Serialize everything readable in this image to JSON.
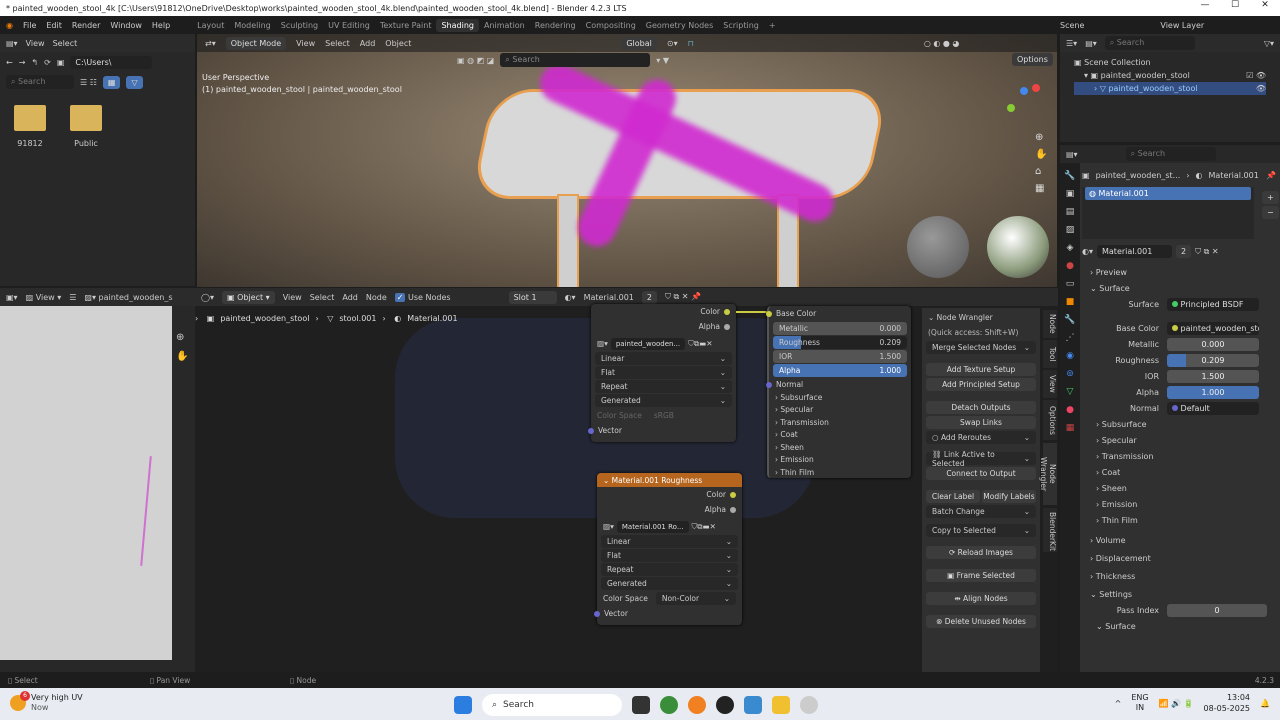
{
  "title": "* painted_wooden_stool_4k [C:\\Users\\91812\\OneDrive\\Desktop\\works\\painted_wooden_stool_4k.blend\\painted_wooden_stool_4k.blend] - Blender 4.2.3 LTS",
  "menu": [
    "File",
    "Edit",
    "Render",
    "Window",
    "Help"
  ],
  "workspaces": [
    "Layout",
    "Modeling",
    "Sculpting",
    "UV Editing",
    "Texture Paint",
    "Shading",
    "Animation",
    "Rendering",
    "Compositing",
    "Geometry Nodes",
    "Scripting"
  ],
  "active_workspace": "Shading",
  "filebrowser": {
    "view": "View",
    "select": "Select",
    "path": "C:\\Users\\",
    "search_placeholder": "Search",
    "items": [
      "91812",
      "Public"
    ]
  },
  "viewport": {
    "mode": "Object Mode",
    "menus": [
      "View",
      "Select",
      "Add",
      "Object"
    ],
    "orientation": "Global",
    "search_placeholder": "Search",
    "options": "Options",
    "perspective": "User Perspective",
    "object_info": "(1) painted_wooden_stool | painted_wooden_stool"
  },
  "outliner": {
    "scene": "Scene",
    "view_layer": "View Layer",
    "search_placeholder": "Search",
    "items": [
      "Scene Collection",
      "painted_wooden_stool",
      "painted_wooden_stool"
    ]
  },
  "properties": {
    "search_placeholder": "Search",
    "breadcrumb_object": "painted_wooden_st...",
    "breadcrumb_material": "Material.001",
    "slot": "Material.001",
    "material_name": "Material.001",
    "users": "2",
    "sections": {
      "preview": "Preview",
      "surface": "Surface",
      "volume": "Volume",
      "displacement": "Displacement",
      "thickness": "Thickness",
      "settings": "Settings",
      "surface2": "Surface"
    },
    "surface_label": "Surface",
    "surface_value": "Principled BSDF",
    "fields": [
      {
        "label": "Base Color",
        "value": "painted_wooden_sto..."
      },
      {
        "label": "Metallic",
        "value": "0.000"
      },
      {
        "label": "Roughness",
        "value": "0.209"
      },
      {
        "label": "IOR",
        "value": "1.500"
      },
      {
        "label": "Alpha",
        "value": "1.000"
      },
      {
        "label": "Normal",
        "value": "Default"
      }
    ],
    "subs": [
      "Subsurface",
      "Specular",
      "Transmission",
      "Coat",
      "Sheen",
      "Emission",
      "Thin Film"
    ],
    "pass_index_label": "Pass Index",
    "pass_index": "0"
  },
  "imageeditor": {
    "view": "View",
    "image": "painted_wooden_s"
  },
  "nodeeditor": {
    "object_mode": "Object",
    "menus": [
      "View",
      "Select",
      "Add",
      "Node"
    ],
    "use_nodes": "Use Nodes",
    "slot": "Slot 1",
    "material": "Material.001",
    "users": "2",
    "breadcrumb": [
      "painted_wooden_stool",
      "stool.001",
      "Material.001"
    ],
    "tex1": {
      "out_color": "Color",
      "out_alpha": "Alpha",
      "image": "painted_wooden...",
      "interp": "Linear",
      "proj": "Flat",
      "ext": "Repeat",
      "src": "Generated",
      "cs_label": "Color Space",
      "cs": "sRGB",
      "vector": "Vector"
    },
    "tex2": {
      "title": "Material.001 Roughness",
      "out_color": "Color",
      "out_alpha": "Alpha",
      "image": "Material.001 Ro...",
      "interp": "Linear",
      "proj": "Flat",
      "ext": "Repeat",
      "src": "Generated",
      "cs_label": "Color Space",
      "cs": "Non-Color",
      "vector": "Vector"
    },
    "bsdf": {
      "base_color": "Base Color",
      "metallic": "Metallic",
      "metallic_v": "0.000",
      "roughness": "Roughness",
      "roughness_v": "0.209",
      "roughness_frac": 0.209,
      "ior": "IOR",
      "ior_v": "1.500",
      "alpha": "Alpha",
      "alpha_v": "1.000",
      "normal": "Normal",
      "subs": [
        "Subsurface",
        "Specular",
        "Transmission",
        "Coat",
        "Sheen",
        "Emission",
        "Thin Film"
      ]
    },
    "wrangler": {
      "title": "Node Wrangler",
      "quick": "(Quick access: Shift+W)",
      "merge": "Merge Selected Nodes",
      "add_texture": "Add Texture Setup",
      "add_principled": "Add Principled Setup",
      "detach": "Detach Outputs",
      "swap": "Swap Links",
      "reroutes": "Add Reroutes",
      "link_active": "Link Active to Selected",
      "connect_output": "Connect to Output",
      "clear_label": "Clear Label",
      "modify_labels": "Modify Labels",
      "batch": "Batch Change",
      "copy": "Copy to Selected",
      "reload": "Reload Images",
      "frame": "Frame Selected",
      "align": "Align Nodes",
      "delete_unused": "Delete Unused Nodes"
    },
    "side_tabs": [
      "Node",
      "Tool",
      "View",
      "Options",
      "Node Wrangler",
      "BlenderKit"
    ]
  },
  "status": {
    "select": "Select",
    "pan": "Pan View",
    "node": "Node",
    "version": "4.2.3"
  },
  "taskbar": {
    "weather_title": "Very high UV",
    "weather_sub": "Now",
    "weather_badge": "6",
    "search": "Search",
    "lang1": "ENG",
    "lang2": "IN",
    "time": "13:04",
    "date": "08-05-2025"
  }
}
